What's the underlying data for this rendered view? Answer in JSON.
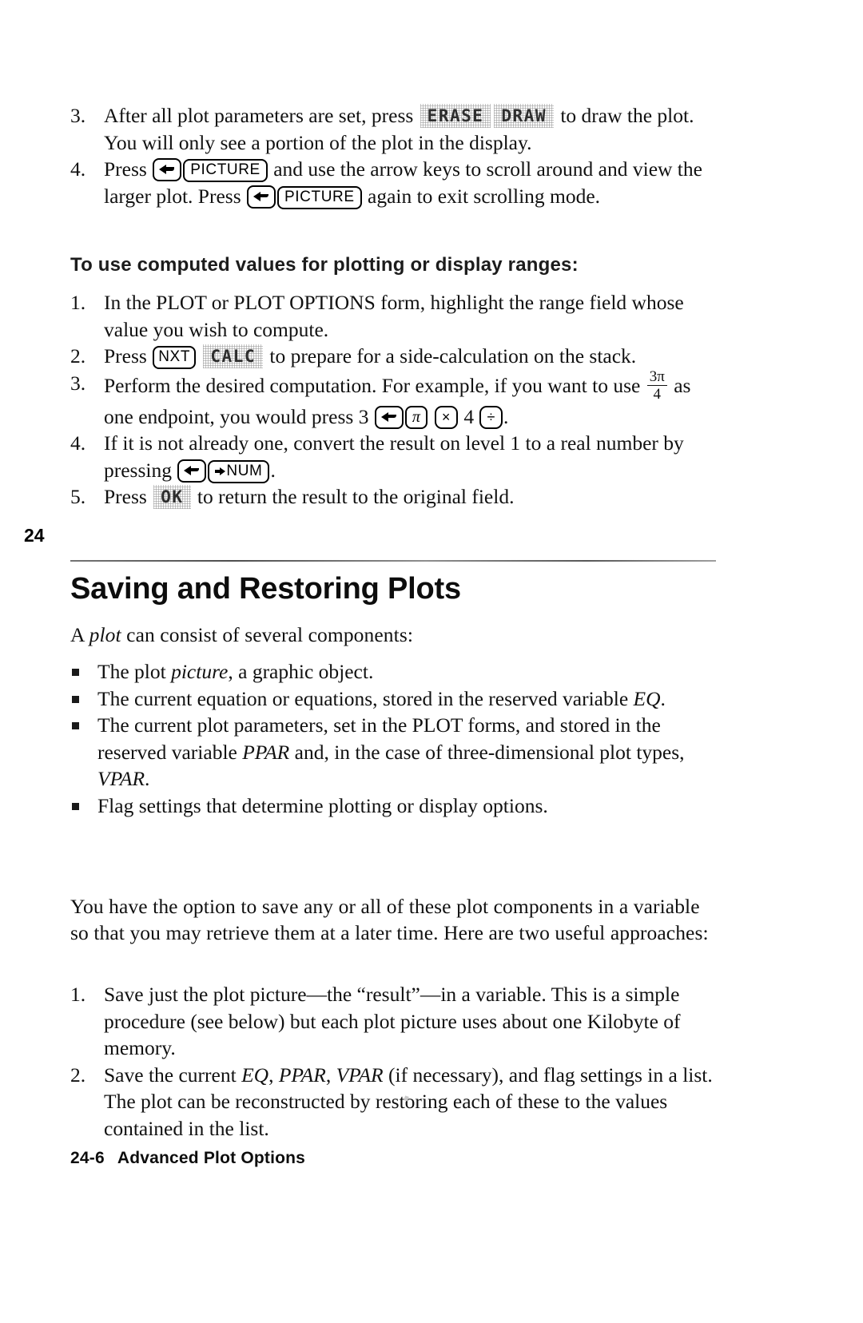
{
  "page": {
    "chapter_tab": "24",
    "chapter_title": "Saving and Restoring Plots",
    "footer_page": "24-6",
    "footer_title": "Advanced Plot Options"
  },
  "top_steps": {
    "items": [
      {
        "num": "3.",
        "part1": "After all plot parameters are set, press",
        "softkey1": "ERASE",
        "softkey2": "DRAW",
        "part2": "to draw the plot. You will only see a portion of the plot in the display."
      },
      {
        "num": "4.",
        "part1": "Press",
        "key_shift": "left-shift",
        "key_picture": "PICTURE",
        "part2": "and use the arrow keys to scroll around and view the larger plot. Press",
        "part3": "again to exit scrolling mode."
      }
    ]
  },
  "subsection": {
    "heading": "To use computed values for plotting or display ranges:",
    "steps": [
      {
        "num": "1.",
        "text": "In the PLOT or PLOT OPTIONS form, highlight the range field whose value you wish to compute."
      },
      {
        "num": "2.",
        "part1": "Press",
        "key_nxt": "NXT",
        "softkey_calc": "CALC",
        "part2": "to prepare for a side-calculation on the stack."
      },
      {
        "num": "3.",
        "part1": "Perform the desired computation. For example, if you want to use",
        "frac_numerator": "3π",
        "frac_denominator": "4",
        "part2": "as one endpoint, you would press 3",
        "key_pi": "π",
        "key_times": "×",
        "digit_4": "4",
        "key_divide": "÷",
        "part3": "."
      },
      {
        "num": "4.",
        "part1": "If it is not already one, convert the result on level 1 to a real number by pressing",
        "key_num": "NUM",
        "part2": "."
      },
      {
        "num": "5.",
        "part1": "Press",
        "softkey_ok": "OK",
        "part2": "to return the result to the original field."
      }
    ]
  },
  "body": {
    "intro": "A plot can consist of several components:",
    "intro_italic": "plot",
    "bullets": [
      {
        "pre": "The plot ",
        "italic": "picture",
        "post": ", a graphic object."
      },
      {
        "pre": "The current equation or equations, stored in the reserved variable ",
        "italic": "EQ",
        "post": "."
      },
      {
        "pre": "The current plot parameters, set in the PLOT forms, and stored in the reserved variable ",
        "italic": "PPAR",
        "mid": " and, in the case of three-dimensional plot types, ",
        "italic2": "VPAR",
        "post": "."
      },
      {
        "pre": "Flag settings that determine plotting or display options.",
        "italic": "",
        "post": ""
      }
    ],
    "option_para": "You have the option to save any or all of these plot components in a variable so that you may retrieve them at a later time. Here are two useful approaches:",
    "approaches": [
      {
        "num": "1.",
        "text": "Save just the plot picture—the “result”—in a variable. This is a simple procedure (see below) but each plot picture uses about one Kilobyte of memory."
      },
      {
        "num": "2.",
        "pre": "Save the current ",
        "it1": "EQ",
        "s1": ", ",
        "it2": "PPAR",
        "s2": ", ",
        "it3": "VPAR",
        "post": " (if necessary), and flag settings in a list. The plot can be reconstructed by restoring each of these to the values contained in the list."
      }
    ]
  }
}
